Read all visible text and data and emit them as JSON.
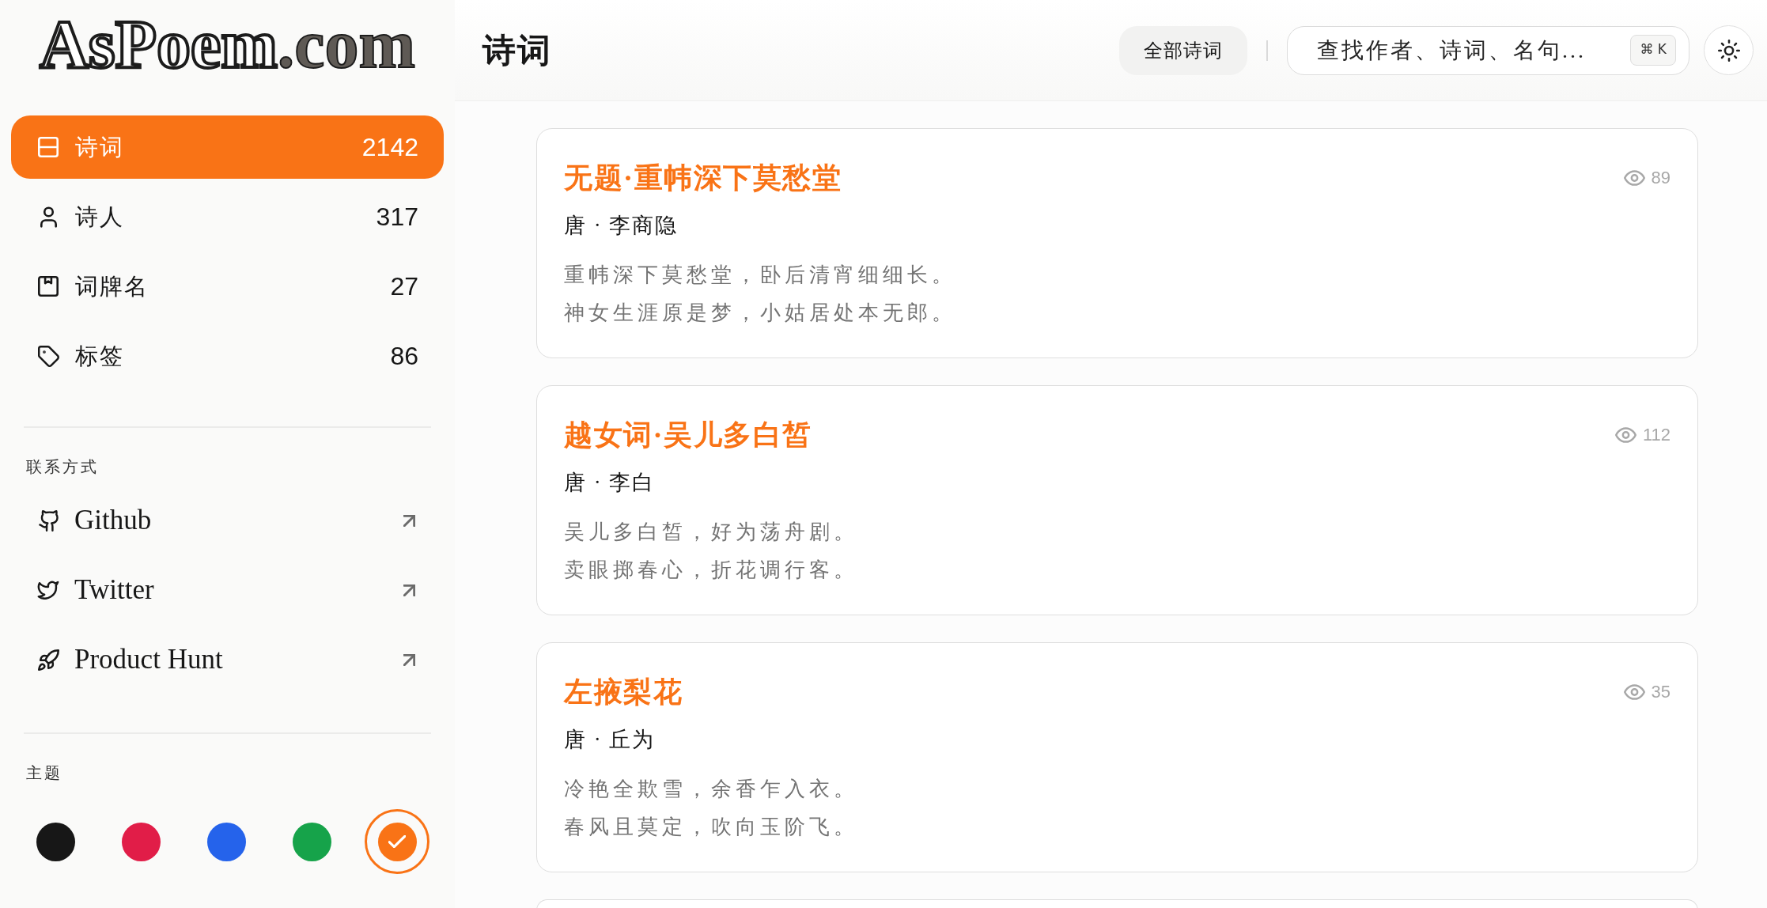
{
  "logo": {
    "name": "AsPoem",
    "domain": ".com"
  },
  "nav": [
    {
      "kind": "panel",
      "label": "诗词",
      "count": "2142",
      "selected": true
    },
    {
      "kind": "user",
      "label": "诗人",
      "count": "317",
      "selected": false
    },
    {
      "kind": "bookmark",
      "label": "词牌名",
      "count": "27",
      "selected": false
    },
    {
      "kind": "tag",
      "label": "标签",
      "count": "86",
      "selected": false
    }
  ],
  "contact": {
    "heading": "联系方式",
    "links": [
      {
        "kind": "github",
        "label": "Github"
      },
      {
        "kind": "bird",
        "label": "Twitter"
      },
      {
        "kind": "rocket",
        "label": "Product Hunt"
      }
    ]
  },
  "theme": {
    "heading": "主题",
    "colors": [
      {
        "color": "#171717",
        "selected": false
      },
      {
        "color": "#e11d48",
        "selected": false
      },
      {
        "color": "#2563eb",
        "selected": false
      },
      {
        "color": "#16a34a",
        "selected": false
      },
      {
        "color": "#f97316",
        "selected": true
      }
    ]
  },
  "header": {
    "title": "诗词",
    "filter": "全部诗词",
    "search": {
      "placeholder": "查找作者、诗词、名句...",
      "shortcut": "⌘ K"
    }
  },
  "poems": [
    {
      "title": "无题·重帏深下莫愁堂",
      "views": "89",
      "author": "唐 · 李商隐",
      "lines": [
        "重帏深下莫愁堂，卧后清宵细细长。",
        "神女生涯原是梦，小姑居处本无郎。"
      ]
    },
    {
      "title": "越女词·吴儿多白皙",
      "views": "112",
      "author": "唐 · 李白",
      "lines": [
        "吴儿多白皙，好为荡舟剧。",
        "卖眼掷春心，折花调行客。"
      ]
    },
    {
      "title": "左掖梨花",
      "views": "35",
      "author": "唐 · 丘为",
      "lines": [
        "冷艳全欺雪，余香乍入衣。",
        "春风且莫定，吹向玉阶飞。"
      ]
    }
  ]
}
